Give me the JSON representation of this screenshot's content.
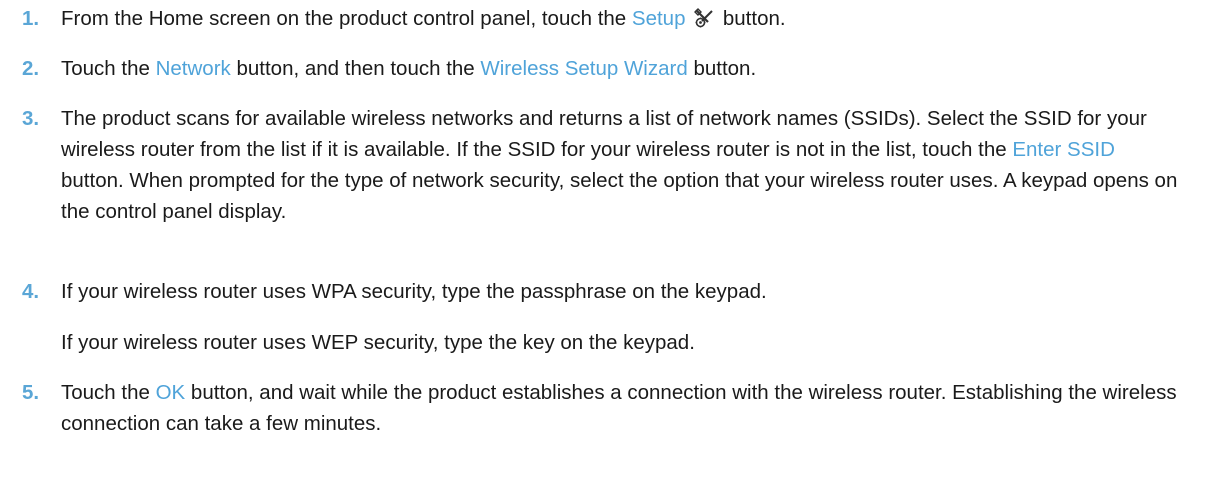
{
  "steps": [
    {
      "number": "1.",
      "parts": [
        "From the Home screen on the product control panel, touch the ",
        "Setup",
        " button."
      ],
      "icon": "setup-wrench-gear-icon"
    },
    {
      "number": "2.",
      "parts": [
        "Touch the ",
        "Network",
        " button, and then touch the ",
        "Wireless Setup Wizard",
        " button."
      ]
    },
    {
      "number": "3.",
      "parts": [
        "The product scans for available wireless networks and returns a list of network names (SSIDs). Select the SSID for your wireless router from the list if it is available. If the SSID for your wireless router is not in the list, touch the ",
        "Enter SSID",
        " button. When prompted for the type of network security, select the option that your wireless router uses. A keypad opens on the control panel display."
      ]
    },
    {
      "number": "4.",
      "para1": "If your wireless router uses WPA security, type the passphrase on the keypad.",
      "para2": "If your wireless router uses WEP security, type the key on the keypad."
    },
    {
      "number": "5.",
      "parts": [
        "Touch the ",
        "OK",
        " button, and wait while the product establishes a connection with the wireless router. Establishing the wireless connection can take a few minutes."
      ]
    }
  ],
  "colors": {
    "ui_term": "#4fa3d9",
    "step_number": "#5aa6d6",
    "text": "#1a1a1a"
  }
}
